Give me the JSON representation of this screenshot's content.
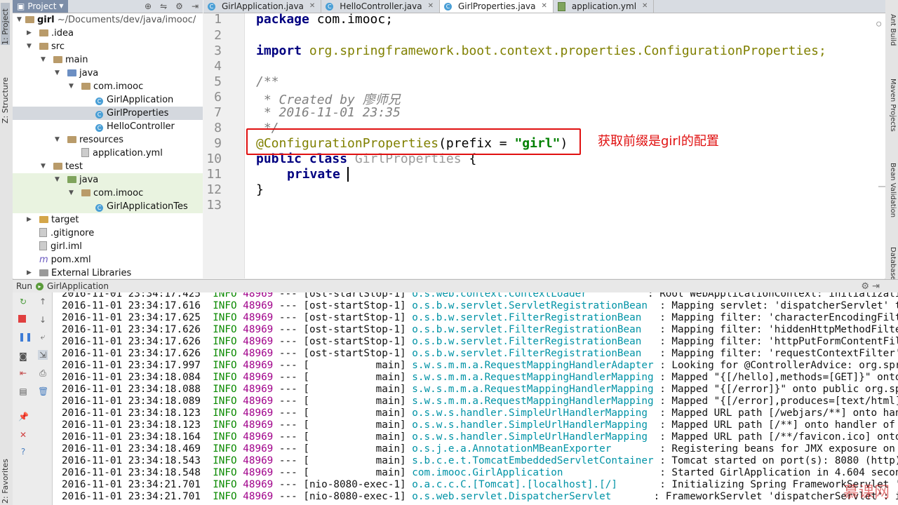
{
  "left_strip": {
    "project": "1: Project",
    "structure": "Z: Structure",
    "favorites": "2: Favorites"
  },
  "right_strip": {
    "ant": "Ant Build",
    "maven": "Maven Projects",
    "bean": "Bean Validation",
    "db": "Database"
  },
  "project_panel": {
    "tab_label": "Project",
    "tree": [
      {
        "label": "girl",
        "suffix": " ~/Documents/dev/java/imooc/"
      },
      {
        "label": ".idea"
      },
      {
        "label": "src"
      },
      {
        "label": "main"
      },
      {
        "label": "java"
      },
      {
        "label": "com.imooc"
      },
      {
        "label": "GirlApplication"
      },
      {
        "label": "GirlProperties"
      },
      {
        "label": "HelloController"
      },
      {
        "label": "resources"
      },
      {
        "label": "application.yml"
      },
      {
        "label": "test"
      },
      {
        "label": "java"
      },
      {
        "label": "com.imooc"
      },
      {
        "label": "GirlApplicationTes"
      },
      {
        "label": "target"
      },
      {
        "label": ".gitignore"
      },
      {
        "label": "girl.iml"
      },
      {
        "label": "pom.xml"
      },
      {
        "label": "External Libraries"
      }
    ]
  },
  "tabs": [
    {
      "label": "GirlApplication.java"
    },
    {
      "label": "HelloController.java"
    },
    {
      "label": "GirlProperties.java"
    },
    {
      "label": "application.yml"
    }
  ],
  "editor": {
    "line_numbers": [
      "1",
      "2",
      "3",
      "4",
      "5",
      "6",
      "7",
      "8",
      "9",
      "10",
      "11",
      "12",
      "13"
    ],
    "line1_kw": "package",
    "line1_rest": " com.imooc;",
    "line3_kw": "import",
    "line3_rest": " org.springframework.boot.context.properties.ConfigurationProperties;",
    "line5": "/**",
    "line6": " * Created by 廖师兄",
    "line7": " * 2016-11-01 23:35",
    "line8": " */",
    "line9_ann": "@ConfigurationProperties",
    "line9_mid": "(prefix = ",
    "line9_str": "\"girl\"",
    "line9_end": ")",
    "line10_kw": "public class",
    "line10_name": " GirlProperties",
    "line10_end": " {",
    "line11": "private",
    "line12": "}"
  },
  "annotation_note": "获取前缀是girl的配置",
  "run_panel": {
    "run_label": "Run",
    "config_name": "GirlApplication",
    "logs": [
      {
        "ts": "2016-11-01 23:34:17.425",
        "lvl": "INFO",
        "pid": "48969",
        "thread": "--- [ost-startStop-1]",
        "logger": "o.s.web.context.ContextLoader",
        "msg": ": Root WebApplicationContext: initialization co"
      },
      {
        "ts": "2016-11-01 23:34:17.616",
        "lvl": "INFO",
        "pid": "48969",
        "thread": "--- [ost-startStop-1]",
        "logger": "o.s.b.w.servlet.ServletRegistrationBean",
        "msg": ": Mapping servlet: 'dispatcherServlet' to [/]"
      },
      {
        "ts": "2016-11-01 23:34:17.625",
        "lvl": "INFO",
        "pid": "48969",
        "thread": "--- [ost-startStop-1]",
        "logger": "o.s.b.w.servlet.FilterRegistrationBean",
        "msg": ": Mapping filter: 'characterEncodingFilter' to:"
      },
      {
        "ts": "2016-11-01 23:34:17.626",
        "lvl": "INFO",
        "pid": "48969",
        "thread": "--- [ost-startStop-1]",
        "logger": "o.s.b.w.servlet.FilterRegistrationBean",
        "msg": ": Mapping filter: 'hiddenHttpMethodFilter' to:"
      },
      {
        "ts": "2016-11-01 23:34:17.626",
        "lvl": "INFO",
        "pid": "48969",
        "thread": "--- [ost-startStop-1]",
        "logger": "o.s.b.w.servlet.FilterRegistrationBean",
        "msg": ": Mapping filter: 'httpPutFormContentFilter' to"
      },
      {
        "ts": "2016-11-01 23:34:17.626",
        "lvl": "INFO",
        "pid": "48969",
        "thread": "--- [ost-startStop-1]",
        "logger": "o.s.b.w.servlet.FilterRegistrationBean",
        "msg": ": Mapping filter: 'requestContextFilter' to: [/"
      },
      {
        "ts": "2016-11-01 23:34:17.997",
        "lvl": "INFO",
        "pid": "48969",
        "thread": "--- [           main]",
        "logger": "s.w.s.m.m.a.RequestMappingHandlerAdapter",
        "msg": ": Looking for @ControllerAdvice: org.springfram"
      },
      {
        "ts": "2016-11-01 23:34:18.084",
        "lvl": "INFO",
        "pid": "48969",
        "thread": "--- [           main]",
        "logger": "s.w.s.m.m.a.RequestMappingHandlerMapping",
        "msg": ": Mapped \"{[/hello],methods=[GET]}\" onto public"
      },
      {
        "ts": "2016-11-01 23:34:18.088",
        "lvl": "INFO",
        "pid": "48969",
        "thread": "--- [           main]",
        "logger": "s.w.s.m.m.a.RequestMappingHandlerMapping",
        "msg": ": Mapped \"{[/error]}\" onto public org.springfra"
      },
      {
        "ts": "2016-11-01 23:34:18.089",
        "lvl": "INFO",
        "pid": "48969",
        "thread": "--- [           main]",
        "logger": "s.w.s.m.m.a.RequestMappingHandlerMapping",
        "msg": ": Mapped \"{[/error],produces=[text/html]}\" onto"
      },
      {
        "ts": "2016-11-01 23:34:18.123",
        "lvl": "INFO",
        "pid": "48969",
        "thread": "--- [           main]",
        "logger": "o.s.w.s.handler.SimpleUrlHandlerMapping",
        "msg": ": Mapped URL path [/webjars/**] onto handler of"
      },
      {
        "ts": "2016-11-01 23:34:18.123",
        "lvl": "INFO",
        "pid": "48969",
        "thread": "--- [           main]",
        "logger": "o.s.w.s.handler.SimpleUrlHandlerMapping",
        "msg": ": Mapped URL path [/**] onto handler of type [c"
      },
      {
        "ts": "2016-11-01 23:34:18.164",
        "lvl": "INFO",
        "pid": "48969",
        "thread": "--- [           main]",
        "logger": "o.s.w.s.handler.SimpleUrlHandlerMapping",
        "msg": ": Mapped URL path [/**/favicon.ico] onto handle"
      },
      {
        "ts": "2016-11-01 23:34:18.469",
        "lvl": "INFO",
        "pid": "48969",
        "thread": "--- [           main]",
        "logger": "o.s.j.e.a.AnnotationMBeanExporter",
        "msg": ": Registering beans for JMX exposure on startup"
      },
      {
        "ts": "2016-11-01 23:34:18.543",
        "lvl": "INFO",
        "pid": "48969",
        "thread": "--- [           main]",
        "logger": "s.b.c.e.t.TomcatEmbeddedServletContainer",
        "msg": ": Tomcat started on port(s): 8080 (http)"
      },
      {
        "ts": "2016-11-01 23:34:18.548",
        "lvl": "INFO",
        "pid": "48969",
        "thread": "--- [           main]",
        "logger": "com.imooc.GirlApplication",
        "msg": ": Started GirlApplication in 4.604 seconds (JVM"
      },
      {
        "ts": "2016-11-01 23:34:21.701",
        "lvl": "INFO",
        "pid": "48969",
        "thread": "--- [nio-8080-exec-1]",
        "logger": "o.a.c.c.C.[Tomcat].[localhost].[/]",
        "msg": ": Initializing Spring FrameworkServlet 'dispatc"
      },
      {
        "ts": "2016-11-01 23:34:21.701",
        "lvl": "INFO",
        "pid": "48969",
        "thread": "--- [nio-8080-exec-1]",
        "logger": "o.s.web.servlet.DispatcherServlet",
        "msg": ": FrameworkServlet 'dispatcherServlet': initial"
      }
    ]
  },
  "watermark": "慕课网"
}
